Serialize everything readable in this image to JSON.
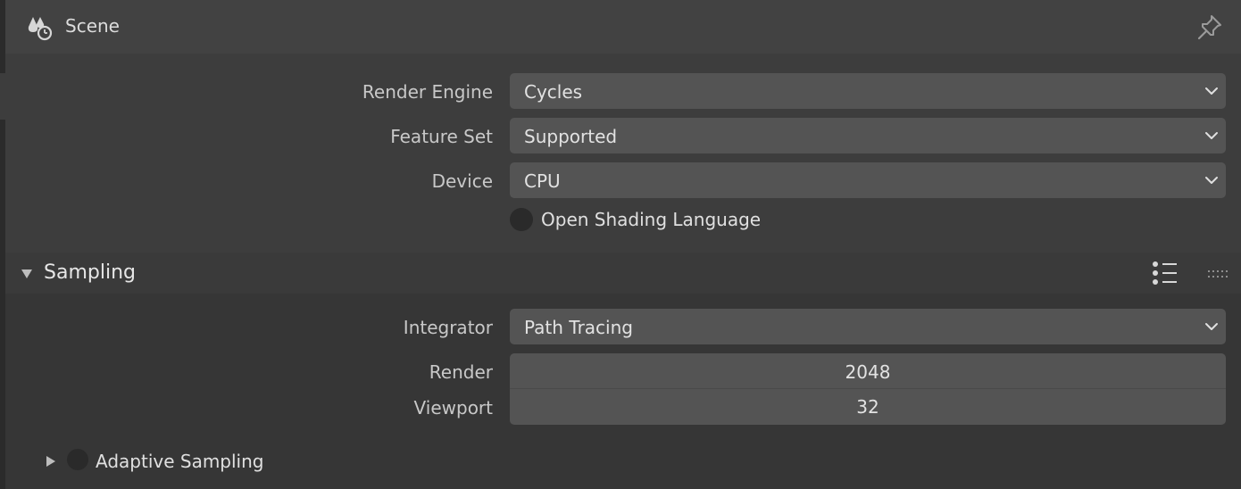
{
  "header": {
    "icon": "scene-icon",
    "title": "Scene",
    "pin_icon": "pin-icon"
  },
  "render": {
    "engine_label": "Render Engine",
    "engine_value": "Cycles",
    "feature_set_label": "Feature Set",
    "feature_set_value": "Supported",
    "device_label": "Device",
    "device_value": "CPU",
    "osl_label": "Open Shading Language"
  },
  "sampling": {
    "title": "Sampling",
    "integrator_label": "Integrator",
    "integrator_value": "Path Tracing",
    "render_label": "Render",
    "render_value": "2048",
    "viewport_label": "Viewport",
    "viewport_value": "32",
    "adaptive_label": "Adaptive Sampling"
  },
  "colors": {
    "background": "#3d3d3d",
    "field": "#545454",
    "text": "#e0e0e0"
  }
}
